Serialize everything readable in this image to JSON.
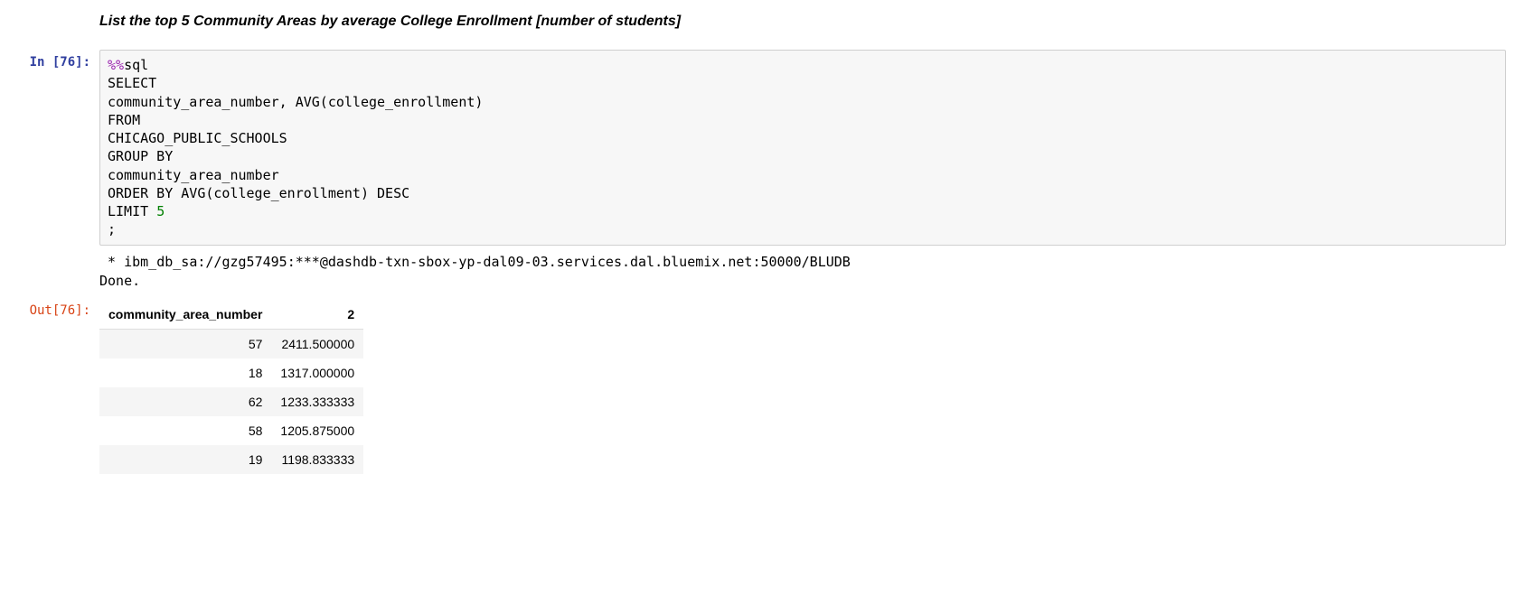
{
  "heading": "List the top 5 Community Areas by average College Enrollment [number of students]",
  "in_prompt": "In [76]:",
  "out_prompt": "Out[76]:",
  "code": {
    "magic": "%%",
    "magic_name": "sql",
    "line1": "SELECT",
    "line2": "community_area_number, AVG(college_enrollment)",
    "line3": "FROM",
    "line4": "CHICAGO_PUBLIC_SCHOOLS",
    "line5": "GROUP BY",
    "line6": "community_area_number",
    "line7": "ORDER BY AVG(college_enrollment) DESC",
    "line8_a": "LIMIT ",
    "line8_b": "5",
    "line9": ";"
  },
  "stdout_line1": " * ibm_db_sa://gzg57495:***@dashdb-txn-sbox-yp-dal09-03.services.dal.bluemix.net:50000/BLUDB",
  "stdout_line2": "Done.",
  "table": {
    "headers": [
      "community_area_number",
      "2"
    ],
    "rows": [
      [
        "57",
        "2411.500000"
      ],
      [
        "18",
        "1317.000000"
      ],
      [
        "62",
        "1233.333333"
      ],
      [
        "58",
        "1205.875000"
      ],
      [
        "19",
        "1198.833333"
      ]
    ]
  }
}
